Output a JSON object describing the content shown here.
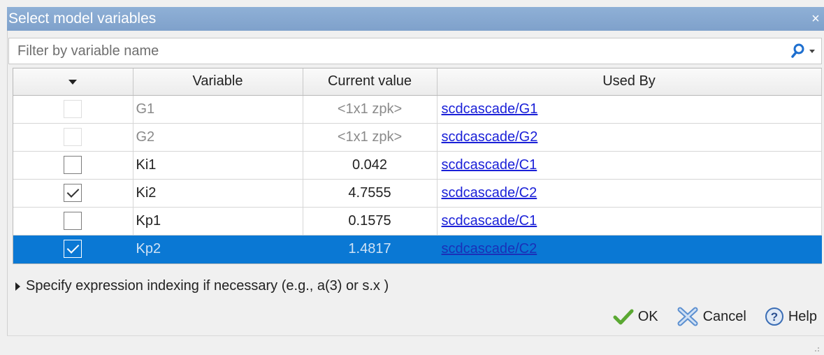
{
  "window": {
    "title": "Select model variables",
    "close_symbol": "×"
  },
  "filter": {
    "placeholder": "Filter by variable name",
    "value": ""
  },
  "table": {
    "headers": {
      "select": "",
      "variable": "Variable",
      "current_value": "Current value",
      "used_by": "Used By"
    },
    "rows": [
      {
        "variable": "G1",
        "value": "<1x1 zpk>",
        "used_by": "scdcascade/G1",
        "checked": false,
        "enabled": false,
        "selected": false
      },
      {
        "variable": "G2",
        "value": "<1x1 zpk>",
        "used_by": "scdcascade/G2",
        "checked": false,
        "enabled": false,
        "selected": false
      },
      {
        "variable": "Ki1",
        "value": "0.042",
        "used_by": "scdcascade/C1",
        "checked": false,
        "enabled": true,
        "selected": false
      },
      {
        "variable": "Ki2",
        "value": "4.7555",
        "used_by": "scdcascade/C2",
        "checked": true,
        "enabled": true,
        "selected": false
      },
      {
        "variable": "Kp1",
        "value": "0.1575",
        "used_by": "scdcascade/C1",
        "checked": false,
        "enabled": true,
        "selected": false
      },
      {
        "variable": "Kp2",
        "value": "1.4817",
        "used_by": "scdcascade/C2",
        "checked": true,
        "enabled": true,
        "selected": true
      }
    ]
  },
  "expression": {
    "label": "Specify expression indexing if necessary (e.g., a(3) or s.x )"
  },
  "buttons": {
    "ok": "OK",
    "cancel": "Cancel",
    "help": "Help"
  },
  "colors": {
    "title_bar": "#7fa1cb",
    "selection": "#0a78d4",
    "link": "#1a20d8",
    "ok_check": "#5aa832"
  },
  "icons": {
    "search": "search-icon",
    "ok": "check-icon",
    "cancel": "x-icon",
    "help": "help-icon"
  }
}
